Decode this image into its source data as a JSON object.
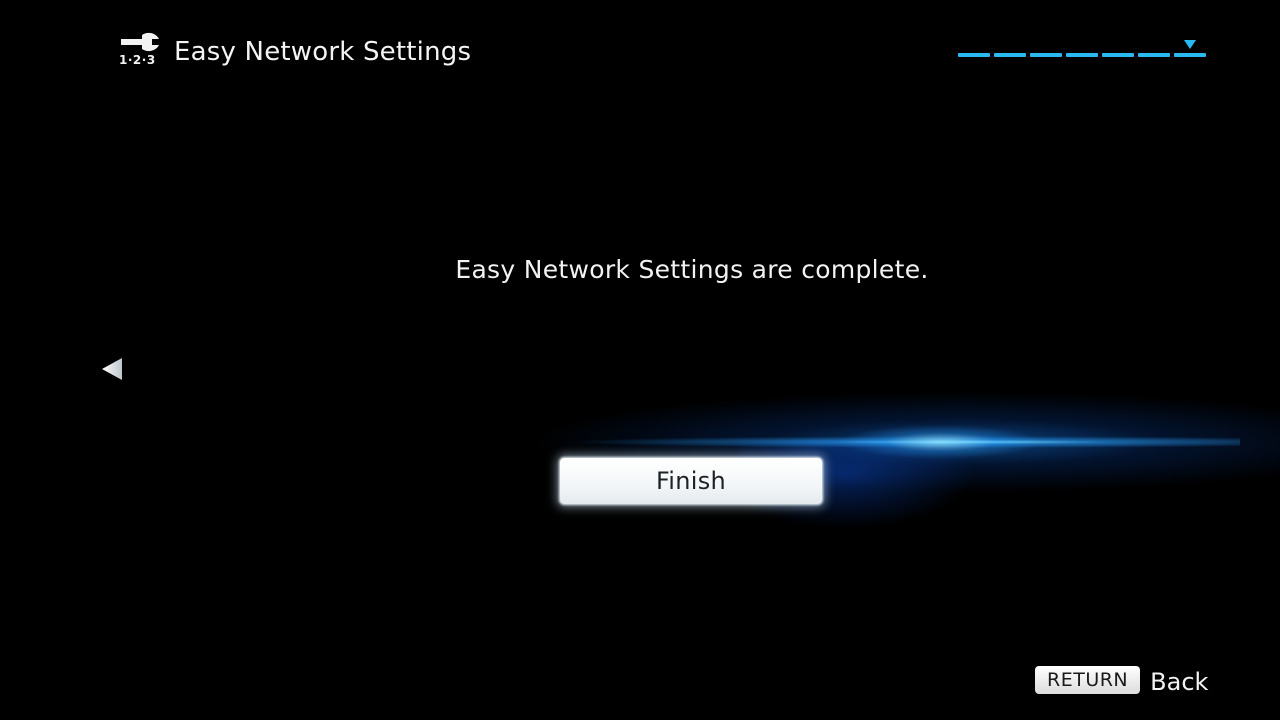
{
  "header": {
    "icon": "setup-tools-icon",
    "icon_caption": "1·2·3",
    "title": "Easy Network Settings"
  },
  "progress": {
    "total_steps": 7,
    "current_step": 7,
    "color": "#29b8f0"
  },
  "main": {
    "message": "Easy Network Settings are complete.",
    "finish_label": "Finish",
    "left_arrow_icon": "left-arrow-icon"
  },
  "footer": {
    "return_key_label": "RETURN",
    "back_label": "Back"
  },
  "colors": {
    "background": "#000000",
    "accent": "#29b8f0",
    "glow": "#1478e6"
  }
}
